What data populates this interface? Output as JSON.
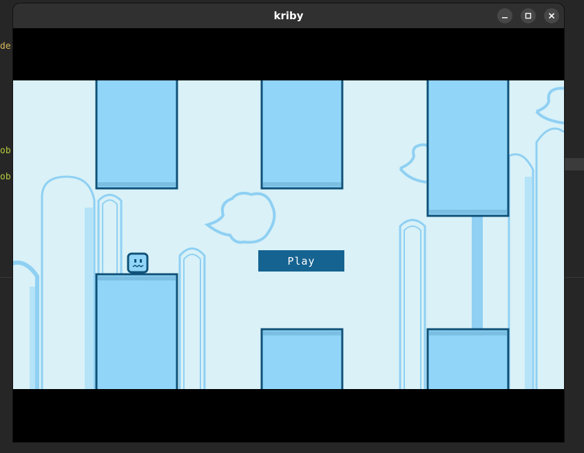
{
  "window": {
    "title": "kriby",
    "controls": {
      "minimize": "–",
      "maximize": "□",
      "close": "✕"
    }
  },
  "background_editor": {
    "fragments": [
      "der",
      "ob",
      "ob"
    ],
    "colors": {
      "fragment_1": "#d7b95a",
      "fragment_2": "#b5c93b"
    }
  },
  "game": {
    "play_label": "Play",
    "colors": {
      "sky": "#d9f1f7",
      "pipe_fill": "#91d5f9",
      "pipe_outline": "#0f5178",
      "decoration": "#8fd0f3",
      "button": "#156391"
    }
  }
}
